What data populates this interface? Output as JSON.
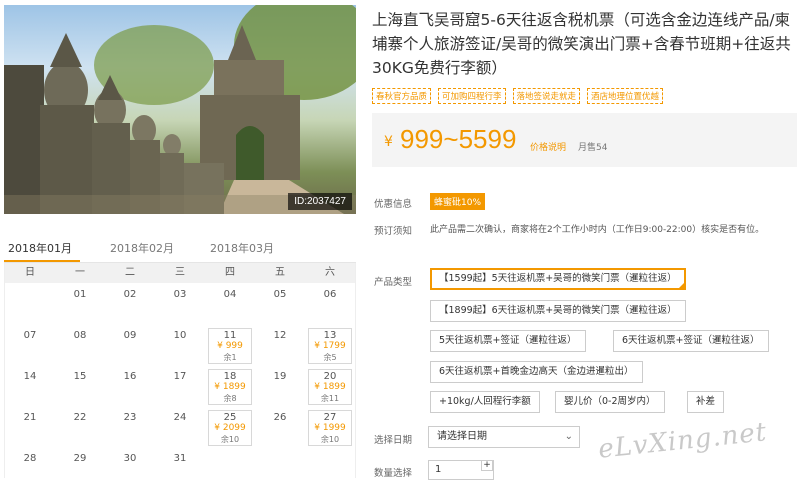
{
  "photo": {
    "id_text": "ID:2037427"
  },
  "calendar": {
    "months": [
      "2018年01月",
      "2018年02月",
      "2018年03月"
    ],
    "active_month": 0,
    "weekdays": [
      "日",
      "一",
      "二",
      "三",
      "四",
      "五",
      "六"
    ],
    "weeks": [
      [
        {
          "d": ""
        },
        {
          "d": "01"
        },
        {
          "d": "02"
        },
        {
          "d": "03"
        },
        {
          "d": "04"
        },
        {
          "d": "05"
        },
        {
          "d": "06"
        }
      ],
      [
        {
          "d": "07"
        },
        {
          "d": "08"
        },
        {
          "d": "09"
        },
        {
          "d": "10"
        },
        {
          "d": "11",
          "p": "¥ 999",
          "s": "余1"
        },
        {
          "d": "12"
        },
        {
          "d": "13",
          "p": "¥ 1799",
          "s": "余5"
        }
      ],
      [
        {
          "d": "14"
        },
        {
          "d": "15"
        },
        {
          "d": "16"
        },
        {
          "d": "17"
        },
        {
          "d": "18",
          "p": "¥ 1899",
          "s": "余8"
        },
        {
          "d": "19"
        },
        {
          "d": "20",
          "p": "¥ 1899",
          "s": "余11"
        }
      ],
      [
        {
          "d": "21"
        },
        {
          "d": "22"
        },
        {
          "d": "23"
        },
        {
          "d": "24"
        },
        {
          "d": "25",
          "p": "¥ 2099",
          "s": "余10"
        },
        {
          "d": "26"
        },
        {
          "d": "27",
          "p": "¥ 1999",
          "s": "余10"
        }
      ],
      [
        {
          "d": "28"
        },
        {
          "d": "29"
        },
        {
          "d": "30"
        },
        {
          "d": "31"
        },
        {
          "d": ""
        },
        {
          "d": ""
        },
        {
          "d": ""
        }
      ]
    ]
  },
  "product": {
    "title": "上海直飞吴哥窟5-6天往返含税机票（可选含金边连线产品/柬埔寨个人旅游签证/吴哥的微笑演出门票+含春节班期+往返共30KG免费行李额）",
    "tags": [
      "春秋官方品质",
      "可加购四程行李",
      "落地签说走就走",
      "酒店地理位置优越"
    ],
    "price_yen": "¥",
    "price_range": "999~5599",
    "price_explain": "价格说明",
    "sold": "月售54"
  },
  "labels": {
    "promo": "优惠信息",
    "notice": "预订须知",
    "type": "产品类型",
    "date": "选择日期",
    "qty": "数量选择"
  },
  "promo_badge": "蜂蜜砒10%",
  "notice_text": "此产品需二次确认，商家将在2个工作小时内（工作日9:00-22:00）核实是否有位。",
  "options": [
    "【1599起】5天往返机票+吴哥的微笑门票（暹粒往返）",
    "【1899起】6天往返机票+吴哥的微笑门票（暹粒往返）",
    "5天往返机票+签证（暹粒往返）",
    "6天往返机票+签证（暹粒往返）",
    "6天往返机票+首晚金边高天（金边进暹粒出）",
    "+10kg/人回程行李额",
    "婴儿价（0-2周岁内）",
    "补差"
  ],
  "date_select": {
    "placeholder": "请选择日期",
    "chevron": "⌄"
  },
  "qty": {
    "value": "1",
    "plus": "+"
  },
  "watermark": "eLvXing.net",
  "colors": {
    "accent": "#f39800",
    "price_bg": "#f4f4f4"
  }
}
